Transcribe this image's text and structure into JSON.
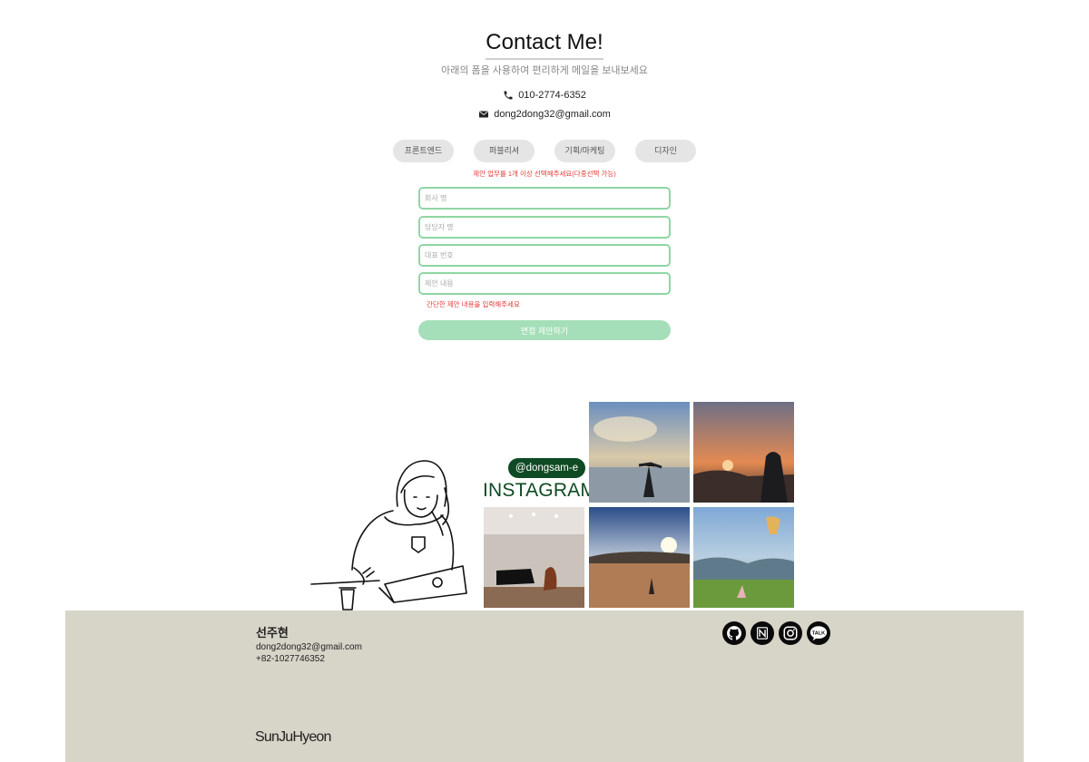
{
  "contact": {
    "title": "Contact Me!",
    "subtitle": "아래의 폼을 사용하여 편리하게 메일을 보내보세요",
    "phone": "010-2774-6352",
    "email": "dong2dong32@gmail.com"
  },
  "form": {
    "chips": [
      "프론트엔드",
      "퍼블리셔",
      "기획/마케팅",
      "디자인"
    ],
    "chip_warning": "제안 업무를 1개 이상 선택해주세요(다중선택 가능)",
    "fields": [
      {
        "placeholder": "회사 명",
        "value": ""
      },
      {
        "placeholder": "담당자 명",
        "value": ""
      },
      {
        "placeholder": "대표 번호",
        "value": ""
      },
      {
        "placeholder": "제안 내용",
        "value": ""
      }
    ],
    "content_warning": "간단한 제안 내용을 입력해주세요",
    "submit_label": "면접 제안하기"
  },
  "instagram": {
    "handle": "@dongsam-e",
    "label": "INSTAGRAM"
  },
  "footer": {
    "name": "선주현",
    "email": "dong2dong32@gmail.com",
    "phone": "+82-1027746352",
    "signature": "SunJuHyeon",
    "socials": [
      "github-icon",
      "notion-icon",
      "instagram-icon",
      "kakaotalk-icon"
    ],
    "kakao_text": "TALK"
  },
  "colors": {
    "accent_green": "#8fd6a4",
    "button_green": "#a5dfb9",
    "warning_red": "#e53935",
    "instagram_green": "#0e4a23",
    "footer_bg": "#d7d4c8"
  }
}
